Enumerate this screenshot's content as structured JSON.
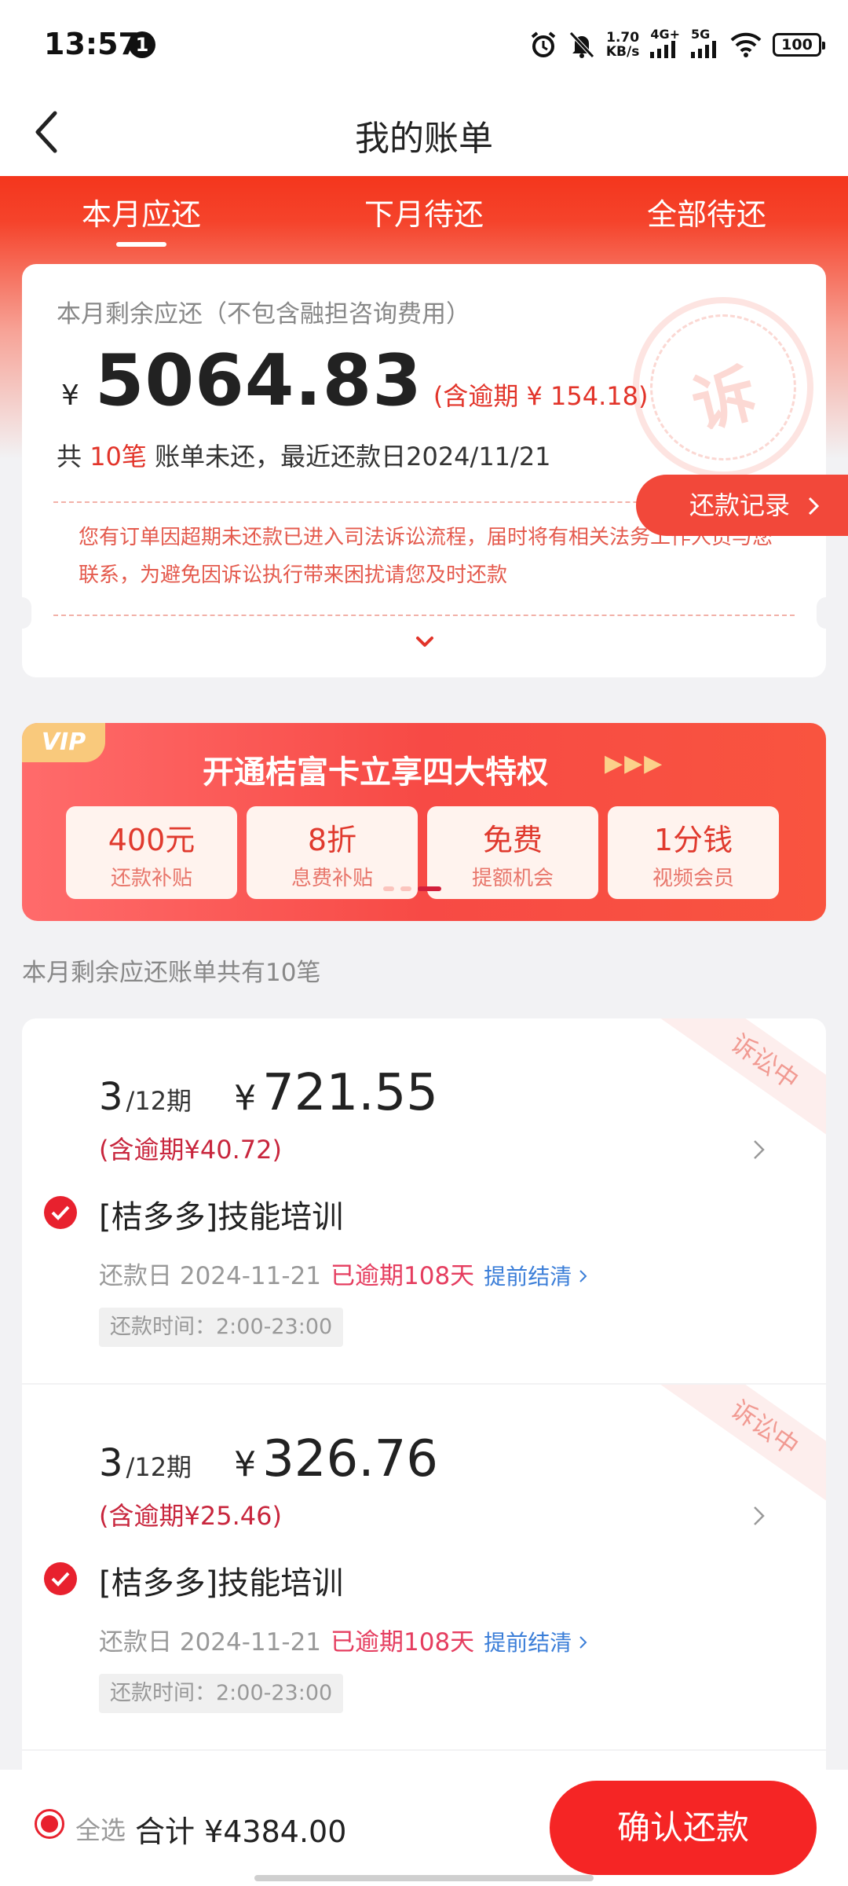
{
  "status_bar": {
    "time": "13:57",
    "notification_count": "1",
    "net_speed": "1.70",
    "net_speed_unit": "KB/s",
    "signal1": "4G+",
    "signal2": "5G",
    "battery": "100"
  },
  "header": {
    "title": "我的账单"
  },
  "tabs": [
    {
      "label": "本月应还",
      "active": true
    },
    {
      "label": "下月待还",
      "active": false
    },
    {
      "label": "全部待还",
      "active": false
    }
  ],
  "summary": {
    "label": "本月剩余应还（不包含融担咨询费用）",
    "currency": "¥",
    "amount": "5064.83",
    "overdue": "(含逾期 ¥ 154.18)",
    "bills_prefix": "共",
    "bills_count": "10笔",
    "bills_suffix": "账单未还，最近还款日2024/11/21",
    "seal_text": "诉",
    "record_button": "还款记录",
    "notice": "您有订单因超期未还款已进入司法诉讼流程，届时将有相关法务工作人员与您联系，为避免因诉讼执行带来困扰请您及时还款"
  },
  "vip": {
    "tag": "VIP",
    "title": "开通桔富卡立享四大特权",
    "perks": [
      {
        "main": "400元",
        "sub": "还款补贴"
      },
      {
        "main": "8折",
        "sub": "息费补贴"
      },
      {
        "main": "免费",
        "sub": "提额机会"
      },
      {
        "main": "1分钱",
        "sub": "视频会员"
      }
    ],
    "carousel_active_index": 2
  },
  "list_caption": "本月剩余应还账单共有10笔",
  "bills": [
    {
      "term": "3",
      "total_terms": "/12期",
      "currency": "¥",
      "amount": "721.55",
      "overdue": "(含逾期¥40.72)",
      "name": "[桔多多]技能培训",
      "due_label": "还款日 2024-11-21",
      "overdue_days": "已逾期108天",
      "early_settle": "提前结清",
      "repay_time": "还款时间：2:00-23:00",
      "ribbon": "诉讼中",
      "selected": true
    },
    {
      "term": "3",
      "total_terms": "/12期",
      "currency": "¥",
      "amount": "326.76",
      "overdue": "(含逾期¥25.46)",
      "name": "[桔多多]技能培训",
      "due_label": "还款日 2024-11-21",
      "overdue_days": "已逾期108天",
      "early_settle": "提前结清",
      "repay_time": "还款时间：2:00-23:00",
      "ribbon": "诉讼中",
      "selected": true
    }
  ],
  "bottom_bar": {
    "select_all": "全选",
    "total": "合计 ¥4384.00",
    "confirm": "确认还款"
  },
  "colors": {
    "primary_red": "#f4361d",
    "text_red": "#e2342a",
    "overdue_pink": "#e53d5f",
    "link_blue": "#3b7ed8"
  }
}
